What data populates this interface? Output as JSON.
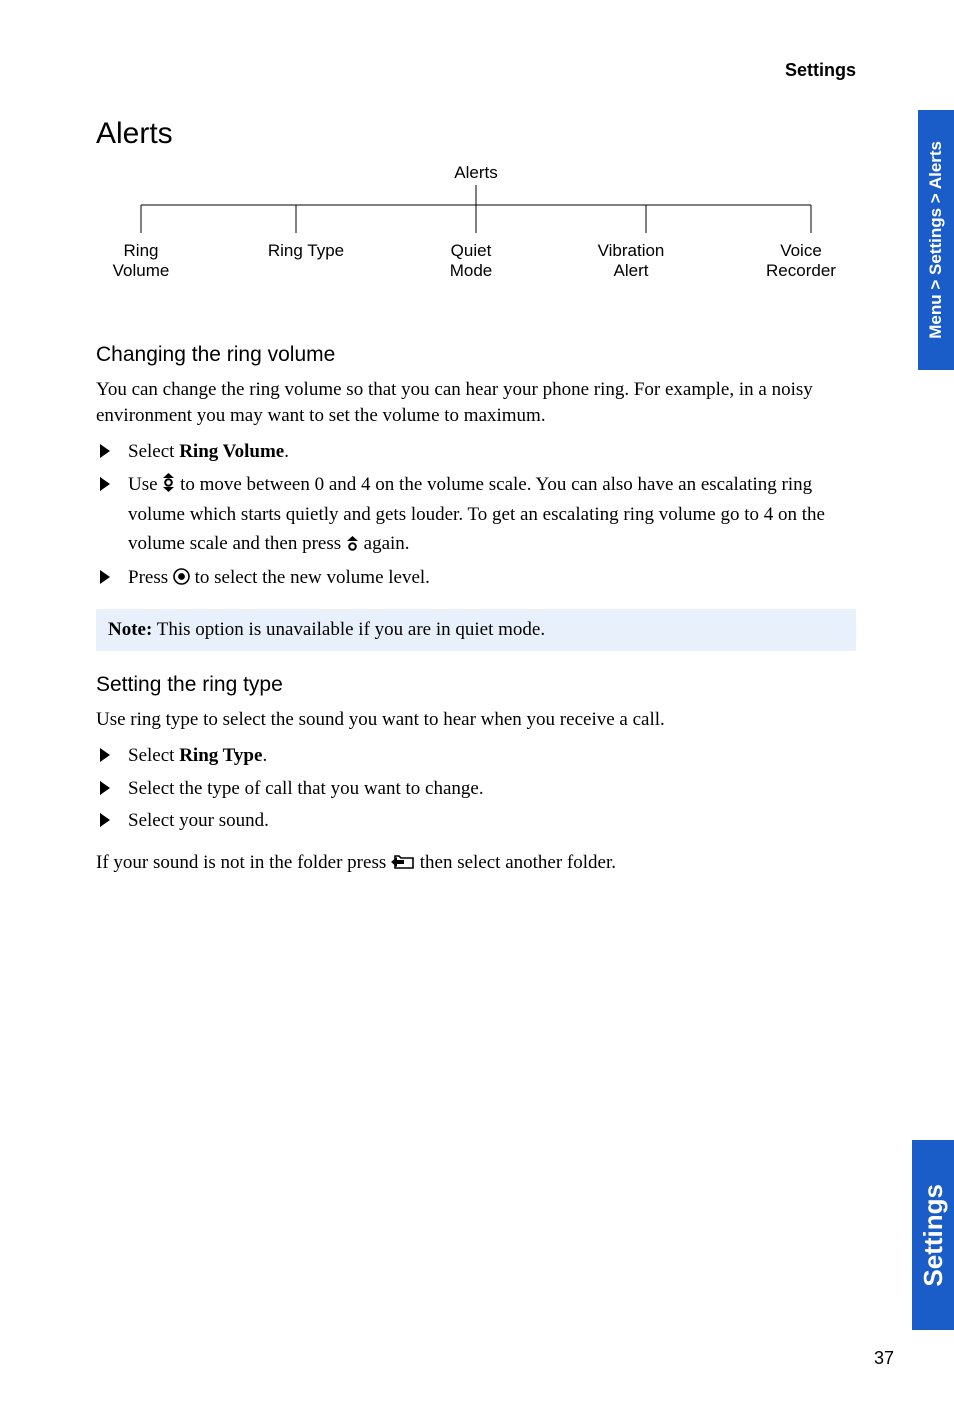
{
  "header": {
    "section": "Settings"
  },
  "title": "Alerts",
  "tree": {
    "root": "Alerts",
    "leaves": [
      "Ring\nVolume",
      "Ring Type",
      "Quiet\nMode",
      "Vibration\nAlert",
      "Voice\nRecorder"
    ]
  },
  "sec1": {
    "heading": "Changing the ring volume",
    "intro": "You can change the ring volume so that you can hear your phone ring. For example, in a noisy environment you may want to set the volume to maximum.",
    "step1_pre": "Select ",
    "step1_bold": "Ring Volume",
    "step1_post": ".",
    "step2_pre": "Use ",
    "step2_mid": " to move between 0 and 4 on the volume scale. You can also have an escalating ring volume which starts quietly and gets louder. To get an escalating ring volume go to 4 on the volume scale and then press ",
    "step2_post": " again.",
    "step3_pre": "Press ",
    "step3_post": " to select the new volume level."
  },
  "note": {
    "label": "Note:",
    "text": " This option is unavailable if you are in quiet mode."
  },
  "sec2": {
    "heading": "Setting the ring type",
    "intro": "Use ring type to select the sound you want to hear when you receive a call.",
    "step1_pre": "Select ",
    "step1_bold": "Ring Type",
    "step1_post": ".",
    "step2": "Select the type of call that you want to change.",
    "step3": "Select your sound.",
    "outro_pre": "If your sound is not in the folder press ",
    "outro_post": " then select another folder."
  },
  "side": {
    "breadcrumb": "Menu > Settings > Alerts",
    "section": "Settings"
  },
  "page_number": "37"
}
